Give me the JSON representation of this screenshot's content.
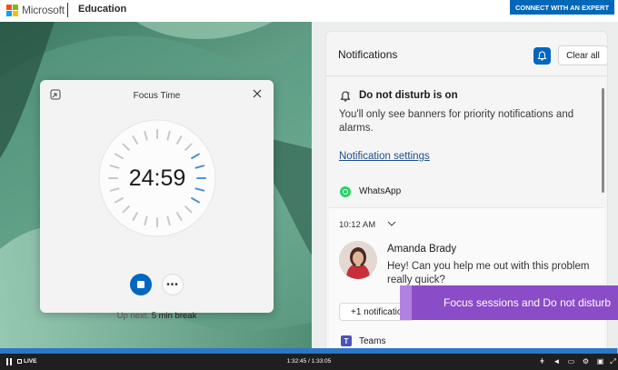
{
  "header": {
    "brand": "Microsoft",
    "section": "Education",
    "cta_label": "CONNECT WITH AN EXPERT",
    "logo_colors": [
      "#f25022",
      "#7fba00",
      "#00a4ef",
      "#ffb900"
    ]
  },
  "focus_timer": {
    "title": "Focus Time",
    "time": "24:59",
    "up_next_prefix": "Up next:",
    "up_next_value": "5 min break",
    "accent": "#0067c0",
    "icons": [
      "mini-view-icon",
      "close-icon",
      "stop-icon",
      "more-icon"
    ]
  },
  "notifications": {
    "title": "Notifications",
    "clear_label": "Clear all",
    "dnd_title": "Do not disturb is on",
    "dnd_body": "You'll only see banners for priority notifications and alarms.",
    "settings_link": "Notification settings",
    "app_whatsapp": "WhatsApp",
    "message": {
      "time": "10:12 AM",
      "sender": "Amanda Brady",
      "body": "Hey! Can you help me out with this problem really quick?",
      "more_label": "+1 notifications"
    },
    "app_teams": "Teams"
  },
  "caption": {
    "text": "Focus sessions and Do not disturb",
    "color": "#8b4cc8"
  },
  "player": {
    "live_label": "LIVE",
    "time": "1:32:45 / 1:33:05",
    "progress_fraction": 0.998
  }
}
